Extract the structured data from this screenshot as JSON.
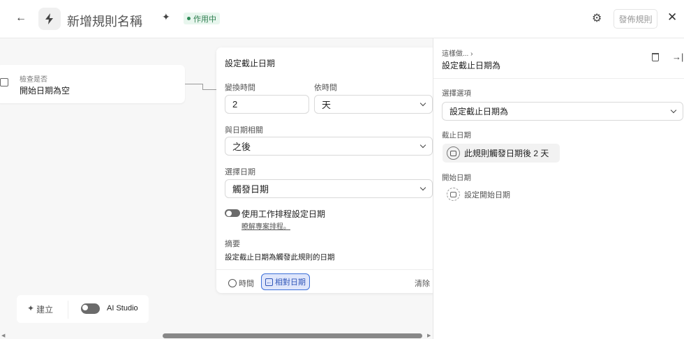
{
  "header": {
    "title": "新增規則名稱",
    "status": "作用中",
    "publish_label": "發佈規則",
    "status_color": "#2e8b57"
  },
  "canvas": {
    "condition_card": {
      "label": "檢查是否",
      "value": "開始日期為空"
    },
    "popover": {
      "title": "設定截止日期",
      "offset_label": "變換時間",
      "offset_value": "2",
      "unit_label": "依時間",
      "unit_value": "天",
      "relation_label": "與日期相關",
      "relation_value": "之後",
      "date_label": "選擇日期",
      "date_value": "觸發日期",
      "schedule_toggle_label": "使用工作排程設定日期",
      "schedule_link": "瞭解專案排程。",
      "summary_label": "摘要",
      "summary_text": "設定截止日期為觸發此規則的日期",
      "tabs": [
        {
          "label": "時間"
        },
        {
          "label": "相對日期"
        }
      ],
      "clear_label": "清除"
    },
    "toolbar": {
      "create_label": "建立",
      "ai_label": "AI Studio"
    }
  },
  "panel": {
    "breadcrumb": "這樣做...",
    "title": "設定截止日期為",
    "option_label": "選擇選項",
    "option_value": "設定截止日期為",
    "due_label": "截止日期",
    "due_value": "此規則觸發日期後 2 天",
    "start_label": "開始日期",
    "start_value": "設定開始日期"
  }
}
